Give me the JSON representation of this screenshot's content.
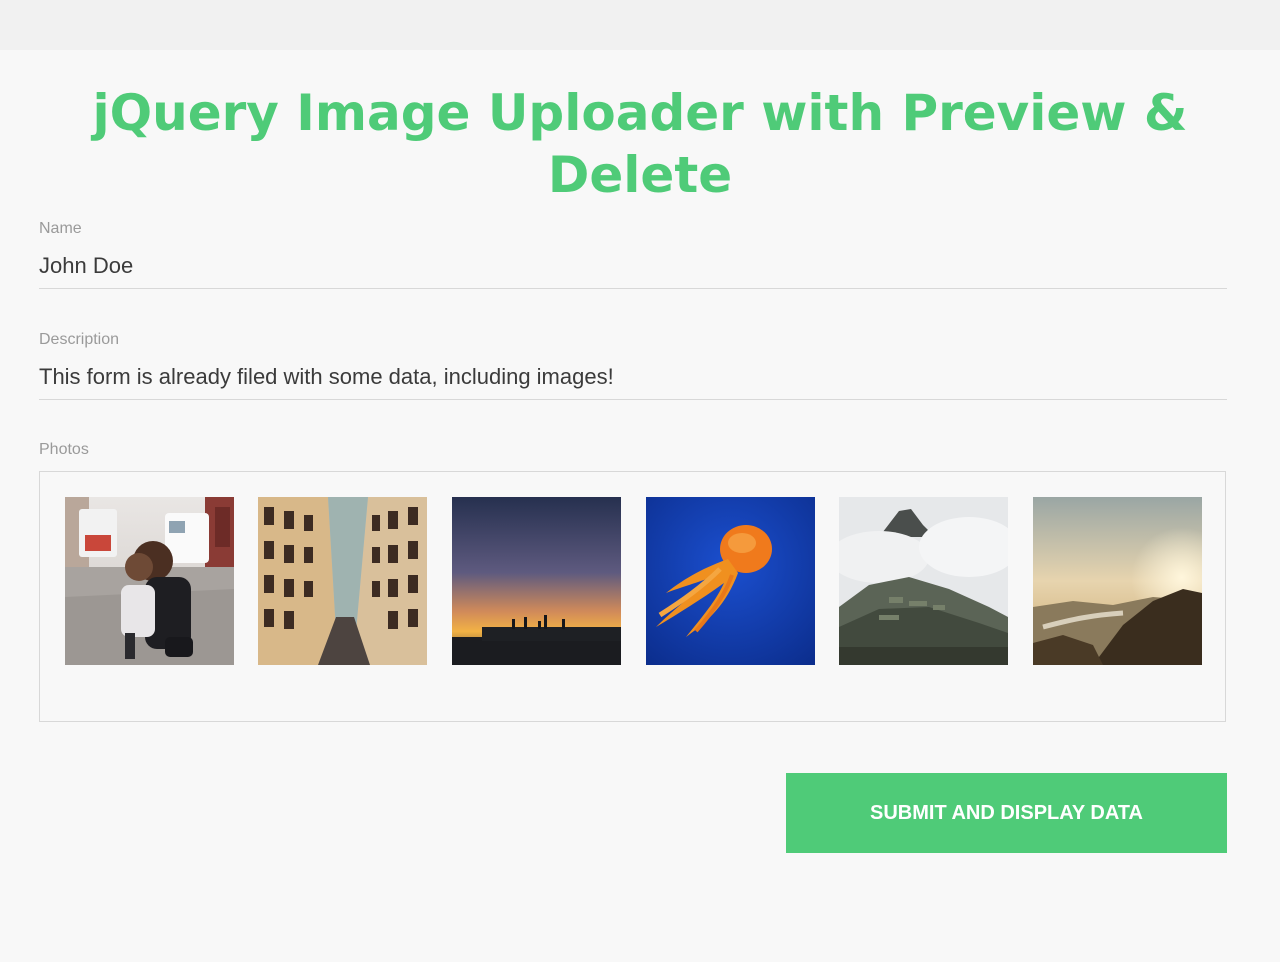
{
  "header": {
    "title": "jQuery Image Uploader with Preview & Delete"
  },
  "form": {
    "name": {
      "label": "Name",
      "value": "John Doe"
    },
    "description": {
      "label": "Description",
      "value": "This form is already filed with some data, including images!"
    },
    "photos": {
      "label": "Photos",
      "items": [
        {
          "subject": "woman hugging child on city street"
        },
        {
          "subject": "narrow street between tall buildings"
        },
        {
          "subject": "sunset over pier"
        },
        {
          "subject": "orange jellyfish in blue water"
        },
        {
          "subject": "misty mountain ruins"
        },
        {
          "subject": "river valley at sunrise"
        }
      ]
    },
    "submit": {
      "label": "SUBMIT AND DISPLAY DATA"
    }
  },
  "colors": {
    "accent": "#4fcb78",
    "background": "#f8f8f8",
    "label": "#9a9a9a",
    "text": "#3b3b3b",
    "border": "#d8d8d8"
  }
}
